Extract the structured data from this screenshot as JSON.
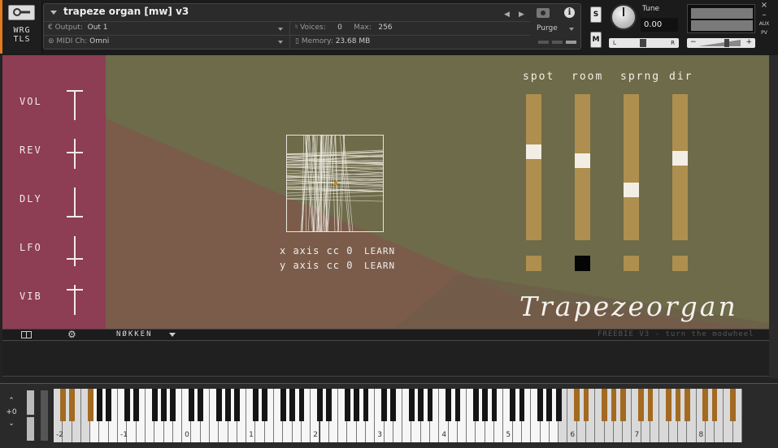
{
  "header": {
    "wrg": "WRG",
    "tls": "TLS",
    "instrument_title": "trapeze organ [mw] v3",
    "output_label": "Output:",
    "output_value": "Out 1",
    "midi_label": "MIDI Ch:",
    "midi_value": "Omni",
    "voices_label": "Voices:",
    "voices_value": "0",
    "max_label": "Max:",
    "max_value": "256",
    "memory_label": "Memory:",
    "memory_value": "23.68 MB",
    "purge_label": "Purge",
    "nav_prev": "◀",
    "nav_next": "▶",
    "info": "i",
    "solo": "S",
    "mute": "M",
    "tune_label": "Tune",
    "tune_value": "0.00",
    "pan_left": "L",
    "pan_right": "R",
    "vol_minus": "−",
    "vol_plus": "+",
    "close": "×",
    "minimize": "–",
    "aux": "AUX",
    "pv": "PV"
  },
  "side_sliders": [
    {
      "label": "VOL",
      "level": 1.0
    },
    {
      "label": "REV",
      "level": 0.5
    },
    {
      "label": "DLY",
      "level": 0.0
    },
    {
      "label": "LFO",
      "level": 0.22
    },
    {
      "label": "VIB",
      "level": 0.85
    }
  ],
  "xy_pad": {
    "x_axis_label": "x axis cc",
    "x_axis_cc": "0",
    "y_axis_label": "y axis cc",
    "y_axis_cc": "0",
    "learn": "LEARN"
  },
  "faders": [
    {
      "label": "spot",
      "level": 0.62,
      "toggle_on": false
    },
    {
      "label": "room",
      "level": 0.55,
      "toggle_on": true
    },
    {
      "label": "sprng",
      "level": 0.33,
      "toggle_on": false
    },
    {
      "label": "dir",
      "level": 0.57,
      "toggle_on": false
    }
  ],
  "logo": "Trapezeorgan",
  "tagline": "FREEBIE V3 - turn the modwheel",
  "footer": {
    "preset": "NØKKEN",
    "text": "FREEBIE V3 - turn the modwheel"
  },
  "keyboard": {
    "octave_shift": "+0",
    "octave_labels": [
      "-2",
      "-1",
      "0",
      "1",
      "2",
      "3",
      "4",
      "5",
      "6",
      "7",
      "8"
    ]
  },
  "colors": {
    "side_panel": "#8d3d54",
    "fader": "#ae8f4f",
    "keyswitch": "#a36a22",
    "highlight_key": "#9cb9d9"
  }
}
